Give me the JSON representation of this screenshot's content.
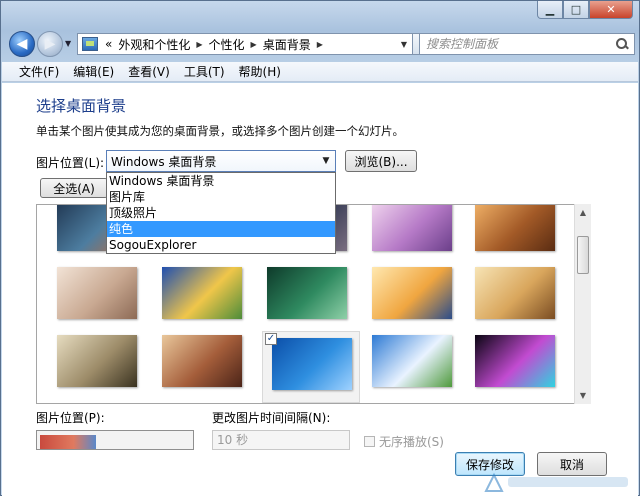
{
  "window": {
    "min_glyph": "▁",
    "max_glyph": "□",
    "close_glyph": "✕"
  },
  "nav": {
    "back_glyph": "◀",
    "forward_glyph": "▶",
    "breadcrumb": [
      "«",
      "外观和个性化",
      "个性化",
      "桌面背景"
    ],
    "refresh_glyph": "↻",
    "search_placeholder": "搜索控制面板"
  },
  "menubar": [
    "文件(F)",
    "编辑(E)",
    "查看(V)",
    "工具(T)",
    "帮助(H)"
  ],
  "main": {
    "heading": "选择桌面背景",
    "subtext": "单击某个图片使其成为您的桌面背景，或选择多个图片创建一个幻灯片。",
    "location_label": "图片位置(L):",
    "location_value": "Windows 桌面背景",
    "browse_label": "浏览(B)...",
    "select_all_label": "全选(A)",
    "location_options": [
      "Windows 桌面背景",
      "图片库",
      "顶级照片",
      "纯色",
      "SogouExplorer"
    ],
    "highlighted_option_index": 3,
    "thumbnails": [
      {
        "name": "particles-thumbnail",
        "colors": [
          "#1f3550",
          "#4d7da0",
          "#c26d3a"
        ]
      },
      {
        "name": "light-thumbnail",
        "colors": [
          "#1d1f28",
          "#3b3f58",
          "#7a6e80"
        ]
      },
      {
        "name": "bokeh-purple-thumbnail",
        "colors": [
          "#f3d9f0",
          "#b67ac7",
          "#6b3f8a"
        ]
      },
      {
        "name": "grass-sunset-thumbnail",
        "colors": [
          "#f4b56a",
          "#a35a27",
          "#5a2c12"
        ]
      },
      {
        "name": "kitten-thumbnail",
        "colors": [
          "#f2e3d6",
          "#c9a992",
          "#8d6a55"
        ]
      },
      {
        "name": "sunset-field-thumbnail",
        "colors": [
          "#1f4fb0",
          "#f0c64a",
          "#4d8c3a"
        ]
      },
      {
        "name": "green-grass-thumbnail",
        "colors": [
          "#0e3a2a",
          "#2f8a60",
          "#8fd0a8"
        ]
      },
      {
        "name": "rocks-sea-thumbnail",
        "colors": [
          "#ffe8b0",
          "#f0a640",
          "#2a4c8a"
        ]
      },
      {
        "name": "wheat-field-thumbnail",
        "colors": [
          "#f7e4b5",
          "#d9a65c",
          "#7a4c22"
        ]
      },
      {
        "name": "bird-sketch-thumbnail",
        "colors": [
          "#e6dcc0",
          "#9c8b68",
          "#3a3220"
        ]
      },
      {
        "name": "girl-portrait-thumbnail",
        "colors": [
          "#e9c79b",
          "#a45d3a",
          "#4b2418"
        ]
      },
      {
        "name": "windows7-logo-thumbnail",
        "colors": [
          "#0b4ea8",
          "#2f8fe0",
          "#9fd2ff"
        ]
      },
      {
        "name": "blue-sky-thumbnail",
        "colors": [
          "#2d7ad4",
          "#e9f3ff",
          "#4f9a3c"
        ]
      },
      {
        "name": "neon-circle-thumbnail",
        "colors": [
          "#0a0512",
          "#c24bd1",
          "#2fd3e0"
        ]
      }
    ],
    "selected_check": "✓",
    "position_label": "图片位置(P):",
    "interval_label": "更改图片时间间隔(N):",
    "interval_value": "10 秒",
    "shuffle_label": "无序播放(S)",
    "save_label": "保存修改",
    "cancel_label": "取消"
  }
}
